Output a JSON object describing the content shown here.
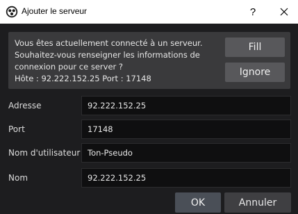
{
  "window": {
    "title": "Ajouter le serveur",
    "help_label": "?",
    "icons": {
      "app": "obs-logo-icon",
      "close": "close-icon"
    }
  },
  "info": {
    "line1": "Vous êtes actuellement connecté à un serveur.",
    "line2": "Souhaitez-vous renseigner les informations de",
    "line3": "connexion pour ce server ?",
    "line4": "Hôte : 92.222.152.25 Port : 17148",
    "fill_label": "Fill",
    "ignore_label": "Ignore"
  },
  "form": {
    "address_label": "Adresse",
    "address_value": "92.222.152.25",
    "port_label": "Port",
    "port_value": "17148",
    "username_label": "Nom d'utilisateur",
    "username_value": "Ton-Pseudo",
    "name_label": "Nom",
    "name_value": "92.222.152.25"
  },
  "buttons": {
    "ok_label": "OK",
    "cancel_label": "Annuler"
  },
  "colors": {
    "background": "#1d1d1f",
    "panel": "#3a3a3c",
    "input": "#0f0f10",
    "button": "#58585b",
    "ok_button": "#4a4f57"
  }
}
